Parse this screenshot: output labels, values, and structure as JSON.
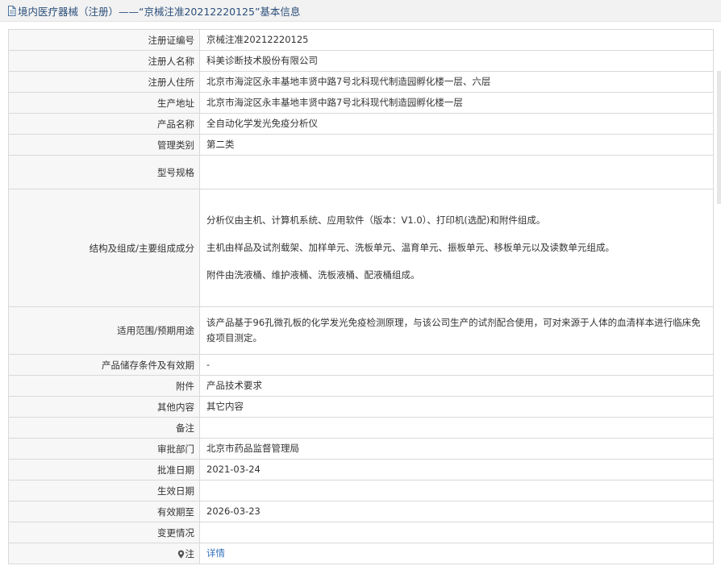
{
  "header": {
    "title": "境内医疗器械（注册）——“京械注准20212220125”基本信息",
    "icon": "document-icon"
  },
  "rows": [
    {
      "label": "注册证编号",
      "value": "京械注准20212220125"
    },
    {
      "label": "注册人名称",
      "value": "科美诊断技术股份有限公司"
    },
    {
      "label": "注册人住所",
      "value": "北京市海淀区永丰基地丰贤中路7号北科现代制造园孵化楼一层、六层"
    },
    {
      "label": "生产地址",
      "value": "北京市海淀区永丰基地丰贤中路7号北科现代制造园孵化楼一层"
    },
    {
      "label": "产品名称",
      "value": "全自动化学发光免疫分析仪"
    },
    {
      "label": "管理类别",
      "value": "第二类"
    },
    {
      "label": "型号规格",
      "value": ""
    },
    {
      "label": "结构及组成/主要组成成分",
      "paragraphs": [
        "分析仪由主机、计算机系统、应用软件（版本：V1.0）、打印机(选配)和附件组成。",
        "主机由样品及试剂载架、加样单元、洗板单元、温育单元、振板单元、移板单元以及读数单元组成。",
        "附件由洗液桶、维护液桶、洗板液桶、配液桶组成。"
      ]
    },
    {
      "label": "适用范围/预期用途",
      "value": "该产品基于96孔微孔板的化学发光免疫检测原理，与该公司生产的试剂配合使用，可对来源于人体的血清样本进行临床免疫项目测定。"
    },
    {
      "label": "产品储存条件及有效期",
      "value": "-"
    },
    {
      "label": "附件",
      "value": "产品技术要求"
    },
    {
      "label": "其他内容",
      "value": "其它内容"
    },
    {
      "label": "备注",
      "value": ""
    },
    {
      "label": "审批部门",
      "value": "北京市药品监督管理局"
    },
    {
      "label": "批准日期",
      "value": "2021-03-24"
    },
    {
      "label": "生效日期",
      "value": ""
    },
    {
      "label": "有效期至",
      "value": "2026-03-23"
    },
    {
      "label": "变更情况",
      "value": ""
    }
  ],
  "note_row": {
    "label": "注",
    "icon": "info-pin-icon",
    "link_text": "详情"
  },
  "colors": {
    "header_bg": "#f2f2f2",
    "header_text": "#2b4f7a",
    "border": "#d9d9d9",
    "link": "#2f6fb8"
  }
}
